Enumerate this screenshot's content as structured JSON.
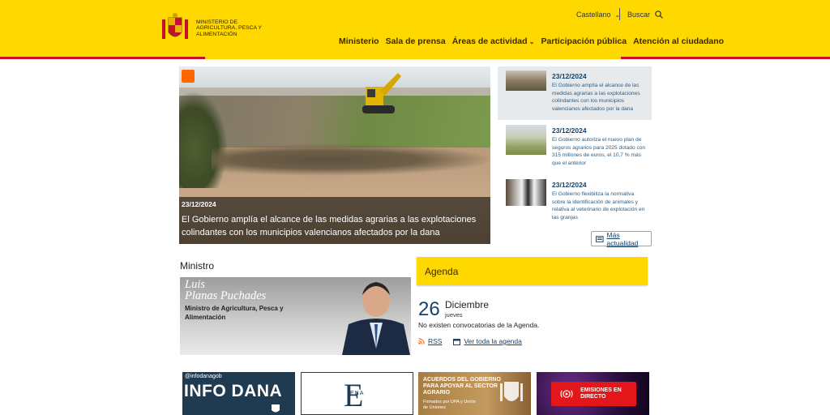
{
  "header": {
    "logo_text": "MINISTERIO DE AGRICULTURA, PESCA Y ALIMENTACIÓN",
    "language": "Castellano",
    "search_label": "Buscar",
    "nav": [
      {
        "label": "Ministerio"
      },
      {
        "label": "Sala de prensa"
      },
      {
        "label": "Áreas de actividad"
      },
      {
        "label": "Participación pública"
      },
      {
        "label": "Atención al ciudadano"
      }
    ]
  },
  "hero": {
    "date": "23/12/2024",
    "title": "El Gobierno amplía el alcance de las medidas agrarias a las explotaciones colindantes con los municipios valencianos afectados por la dana"
  },
  "news": [
    {
      "date": "23/12/2024",
      "text": "El Gobierno amplía el alcance de las medidas agrarias a las explotaciones colindantes con los municipios valencianos afectados por la dana"
    },
    {
      "date": "23/12/2024",
      "text": "El Gobierno autoriza el nuevo plan de seguros agrarios para 2025 dotado con 315 millones de euros, el 10,7 % más que el anterior"
    },
    {
      "date": "23/12/2024",
      "text": "El Gobierno flexibiliza la normativa sobre la identificación de animales y relativa al veterinario de explotación en las granjas"
    }
  ],
  "more_news": "Más actualidad",
  "minister": {
    "section_label": "Ministro",
    "name_line1": "Luis",
    "name_line2": "Planas Puchades",
    "role": "Ministro de Agricultura, Pesca y Alimentación"
  },
  "agenda": {
    "title": "Agenda",
    "day": "26",
    "month": "Diciembre",
    "weekday": "jueves",
    "empty_text": "No existen convocatorias de la Agenda.",
    "rss_label": "RSS",
    "all_label": "Ver toda la agenda"
  },
  "banners": {
    "dana_handle": "@infodanagob",
    "dana_title": "INFO DANA",
    "ena_letter": "E",
    "ena_text": "ENA",
    "acuerdos_title": "ACUERDOS DEL GOBIERNO PARA APOYAR AL SECTOR AGRARIO",
    "acuerdos_sub": "Firmados por UPA y Unión de Uniones",
    "live_text": "EMISIONES EN DIRECTO"
  }
}
